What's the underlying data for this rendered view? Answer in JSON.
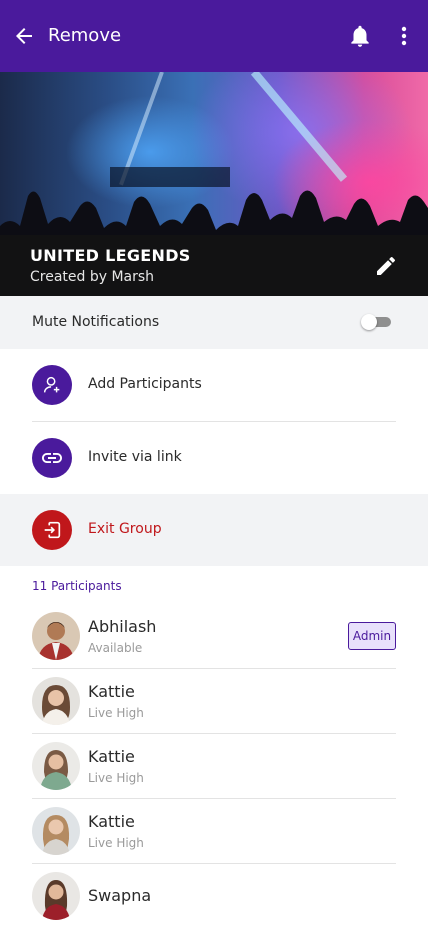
{
  "app_bar": {
    "title": "Remove",
    "back_icon": "arrow-left-icon",
    "notification_icon": "bell-icon",
    "menu_icon": "more-vertical-icon",
    "color": "#4a1a9c"
  },
  "group": {
    "name": "UNITED LEGENDS",
    "created_by": "Created by Marsh",
    "edit_icon": "pencil-icon"
  },
  "settings": {
    "mute_label": "Mute Notifications",
    "mute_enabled": false
  },
  "actions": {
    "add_participants": {
      "label": "Add Participants",
      "icon": "person-add-icon"
    },
    "invite_link": {
      "label": "Invite via link",
      "icon": "link-icon"
    },
    "exit_group": {
      "label": "Exit Group",
      "icon": "exit-icon",
      "color": "#c0171b"
    }
  },
  "participants_count": "11 Participants",
  "participants": [
    {
      "name": "Abhilash",
      "status": "Available",
      "badge": "Admin"
    },
    {
      "name": "Kattie",
      "status": "Live High"
    },
    {
      "name": "Kattie",
      "status": "Live High"
    },
    {
      "name": "Kattie",
      "status": "Live High"
    },
    {
      "name": "Swapna",
      "status": ""
    }
  ]
}
